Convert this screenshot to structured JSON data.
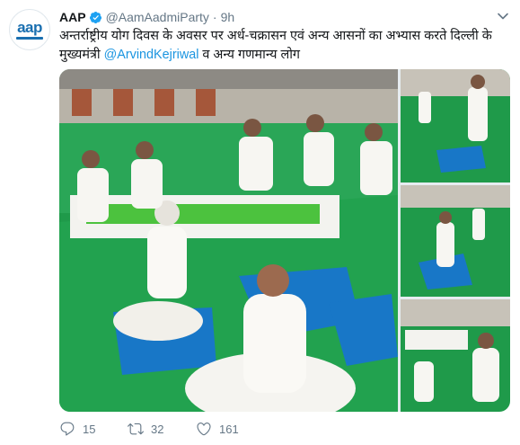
{
  "tweet": {
    "author_name": "AAP",
    "handle": "@AamAadmiParty",
    "dot": "·",
    "time": "9h",
    "avatar_logo": "aap",
    "text_line1": "अन्तर्राष्ट्रीय योग दिवस के अवसर पर अर्ध-चक्रासन एवं अन्य आसनों का अभ्यास करते दिल्ली के",
    "text_line2_prefix": "मुख्यमंत्री ",
    "mention": "@ArvindKejriwal",
    "text_line2_suffix": " व अन्य गणमान्य लोग",
    "replies": "15",
    "retweets": "32",
    "likes": "161"
  },
  "icons": {
    "verified": "verified-badge-icon",
    "caret": "chevron-down-icon",
    "reply": "reply-icon",
    "retweet": "retweet-icon",
    "like": "heart-icon"
  },
  "colors": {
    "accent": "#1b95e0",
    "muted": "#657786",
    "verified": "#1da1f2",
    "brand": "#1a6fb0"
  }
}
